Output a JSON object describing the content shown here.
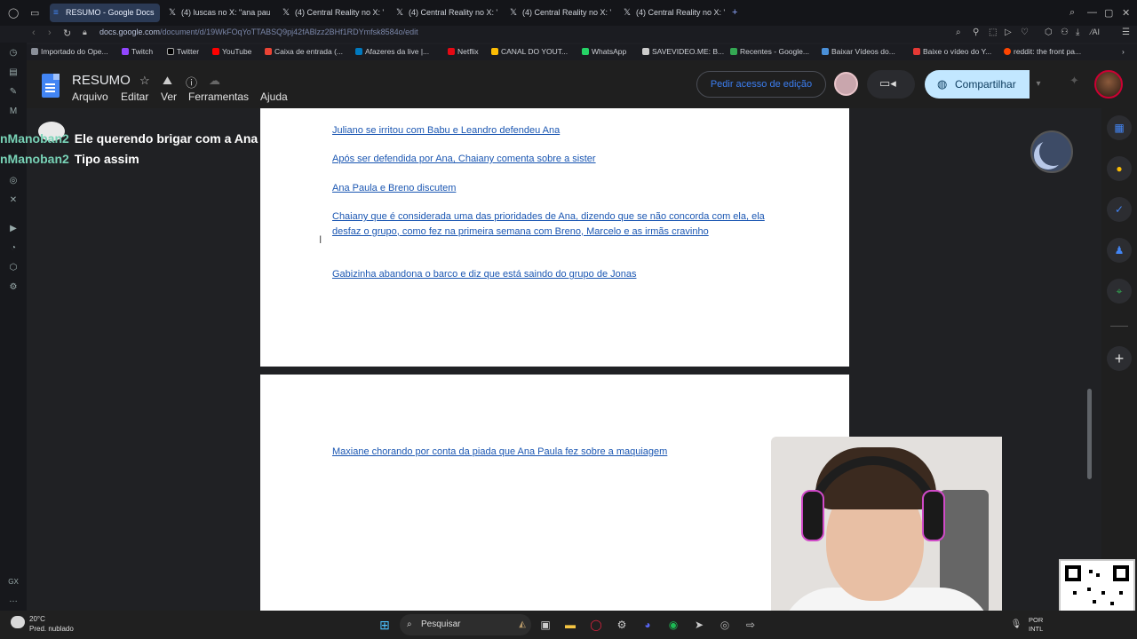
{
  "browser": {
    "tabs": [
      {
        "label": "RESUMO - Google Docs",
        "active": true
      },
      {
        "label": "(4) luscas no X: \"ana pau",
        "active": false
      },
      {
        "label": "(4) Central Reality no X: \"",
        "active": false
      },
      {
        "label": "(4) Central Reality no X: \"",
        "active": false
      },
      {
        "label": "(4) Central Reality no X: \"",
        "active": false
      },
      {
        "label": "(4) Central Reality no X: \"",
        "active": false
      }
    ],
    "url_domain": "docs.google.com",
    "url_path": "/document/d/19WkFOqYoTTABSQ9pj42fABlzz2BHf1RDYmfsk8584o/edit",
    "bookmarks": [
      "Importado do Ope...",
      "Twitch",
      "Twitter",
      "YouTube",
      "Caixa de entrada (...",
      "Afazeres da live |...",
      "Netflix",
      "CANAL DO YOUT...",
      "WhatsApp",
      "SAVEVIDEO.ME: B...",
      "Recentes - Google...",
      "Baixar Vídeos do...",
      "Baixe o vídeo do Y...",
      "reddit: the front pa..."
    ]
  },
  "docs": {
    "title": "RESUMO",
    "menu": [
      "Arquivo",
      "Editar",
      "Ver",
      "Ferramentas",
      "Ajuda"
    ],
    "request_edit": "Pedir acesso de edição",
    "share": "Compartilhar",
    "page1_lines": [
      "Juliano se irritou com Babu e Leandro defendeu Ana",
      "Após ser defendida por Ana, Chaiany comenta sobre a sister",
      "Ana Paula e Breno discutem",
      "Chaiany que é considerada uma das prioridades de Ana, dizendo que se não concorda com ela, ela desfaz o grupo, como fez na primeira semana com Breno, Marcelo e as irmãs cravinho",
      "Gabizinha abandona o barco e diz que está saindo do grupo de Jonas"
    ],
    "page2_lines": [
      "Maxiane chorando por conta da piada que Ana Paula fez sobre a maquiagem"
    ]
  },
  "chat_overlay": [
    {
      "user": "nManoban2",
      "message": "Ele querendo brigar com a Ana"
    },
    {
      "user": "nManoban2",
      "message": "Tipo assim"
    }
  ],
  "taskbar": {
    "weather_temp": "20°C",
    "weather_desc": "Pred. nublado",
    "search_placeholder": "Pesquisar",
    "lang_line1": "POR",
    "lang_line2": "INTL"
  }
}
